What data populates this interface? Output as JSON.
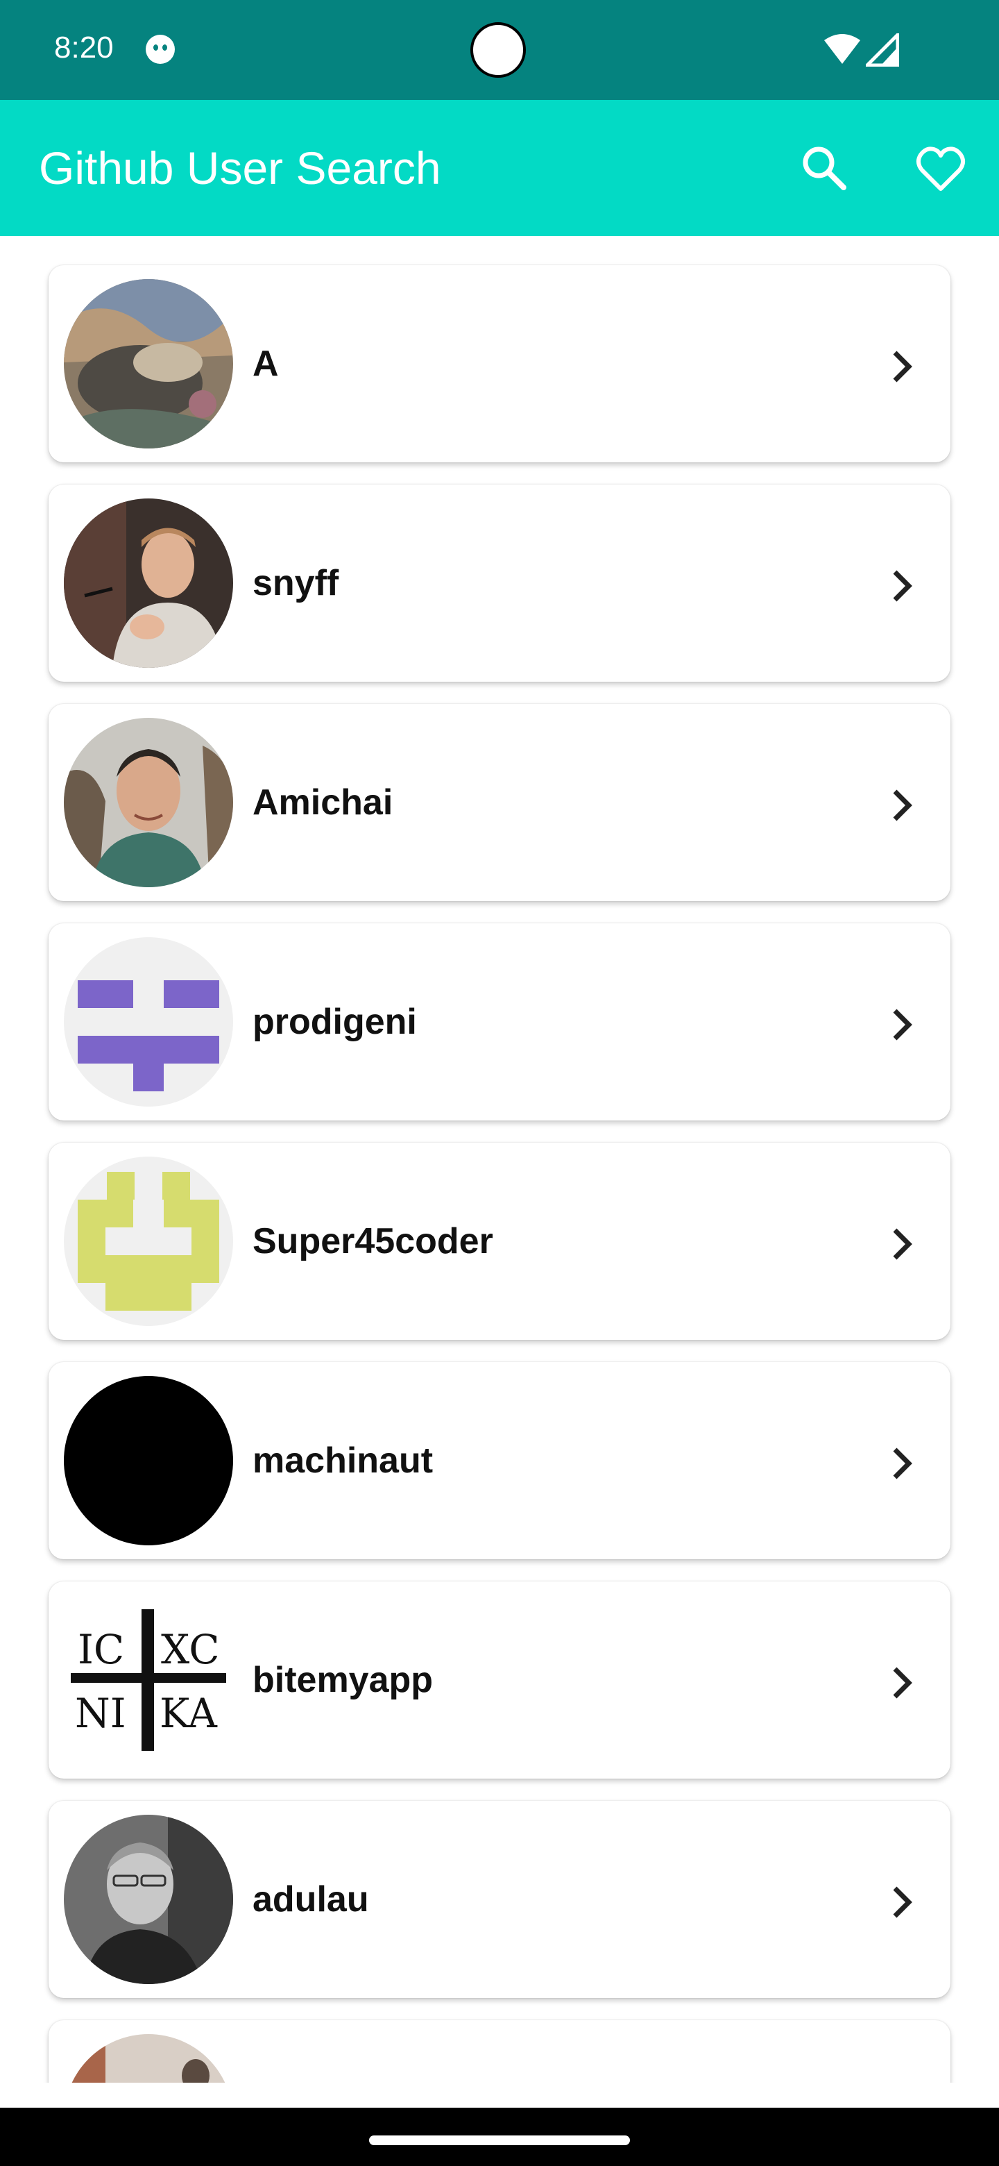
{
  "status_bar": {
    "time": "8:20"
  },
  "app_bar": {
    "title": "Github User Search"
  },
  "icons": {
    "search": "search-icon",
    "favorite": "heart-outline-icon",
    "chevron": "chevron-right-icon"
  },
  "colors": {
    "status_bar": "#05837f",
    "app_bar": "#03dac5",
    "card": "#ffffff"
  },
  "users": [
    {
      "login": "A"
    },
    {
      "login": "snyff"
    },
    {
      "login": "Amichai"
    },
    {
      "login": "prodigeni"
    },
    {
      "login": "Super45coder"
    },
    {
      "login": "machinaut"
    },
    {
      "login": "bitemyapp"
    },
    {
      "login": "adulau"
    },
    {
      "login": ""
    }
  ],
  "avatar_text": {
    "tl": "IC",
    "tr": "XC",
    "bl": "NI",
    "br": "KA"
  }
}
